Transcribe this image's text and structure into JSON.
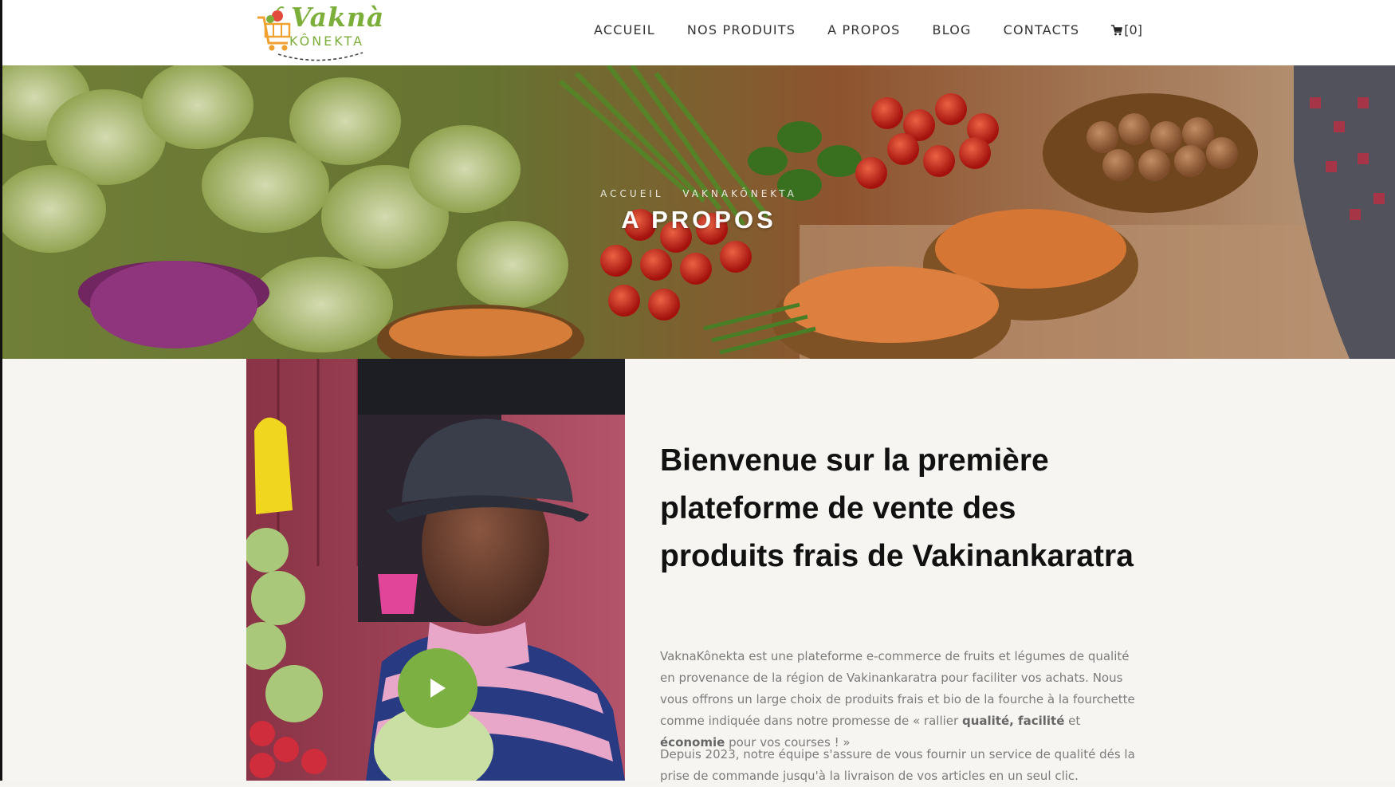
{
  "brand": {
    "name": "Vaknà",
    "subtitle": "KÔNEKTA",
    "accent_color": "#7cae3a"
  },
  "nav": {
    "items": [
      "ACCUEIL",
      "NOS PRODUITS",
      "A PROPOS",
      "BLOG",
      "CONTACTS"
    ],
    "cart_icon": "cart-icon",
    "cart_label": "[0]"
  },
  "hero": {
    "breadcrumb": [
      "ACCUEIL",
      "VAKNAKÔNEKTA"
    ],
    "title": "A PROPOS",
    "image": "vegetable-market-photo"
  },
  "about": {
    "image": "vendor-portrait-photo",
    "play_icon": "play-icon",
    "play_button_color": "#7db043",
    "headline": "Bienvenue sur la première plateforme de vente des produits frais de Vakinankaratra",
    "paragraph1": {
      "intro": "VaknaKônekta est une plateforme e-commerce de fruits et légumes de qualité en provenance de la région de Vakinankaratra pour faciliter vos achats. Nous vous offrons un large choix de produits frais et bio de la fourche à la fourchette comme indiquée dans notre promesse de « rallier",
      "kw1": "qualité, facilité",
      "and": "et",
      "kw2": "économie",
      "outro": "pour vos courses ! »"
    },
    "paragraph2": "Depuis 2023, notre équipe s'assure de vous fournir un service de qualité dés la prise de commande jusqu'à la livraison de vos articles en un seul clic."
  }
}
